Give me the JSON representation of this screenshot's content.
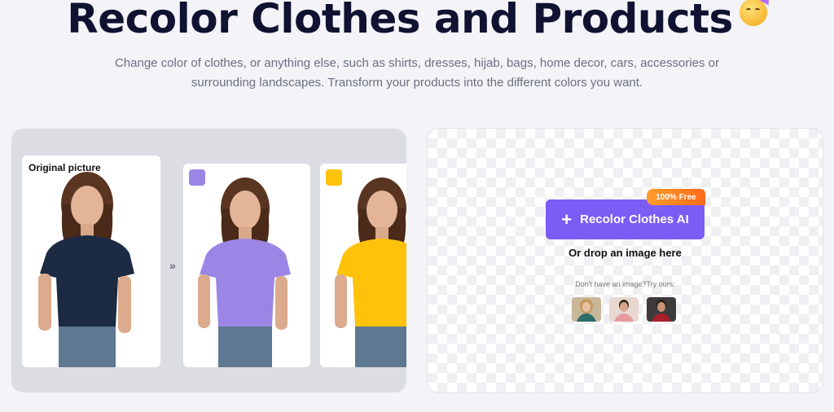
{
  "header": {
    "title": "Recolor Clothes and Products",
    "emoji_icon": "party-face-icon",
    "subtitle_line1": "Change color of clothes, or anything else, such as shirts, dresses, hijab, bags, home decor, cars, accessories or",
    "subtitle_line2": "surrounding landscapes. Transform your products into the different colors you want."
  },
  "examples": {
    "original_label": "Original picture",
    "arrow": "»",
    "cards": [
      {
        "shirt_color": "#1d2a44"
      },
      {
        "shirt_color": "#9b86e6",
        "swatch": "#9b86e6"
      },
      {
        "shirt_color": "#ffc20a",
        "swatch": "#ffc20a"
      }
    ]
  },
  "upload": {
    "button_label": "Recolor Clothes AI",
    "badge": "100% Free",
    "drop_text": "Or drop an image here",
    "try_text": "Don't have an image?Try ours:",
    "samples": [
      "sample-woman-photo",
      "sample-man-photo",
      "sample-man-red-photo"
    ]
  },
  "colors": {
    "accent": "#7b5cf5",
    "badge": "#ff7a1f",
    "title": "#0f1230"
  }
}
